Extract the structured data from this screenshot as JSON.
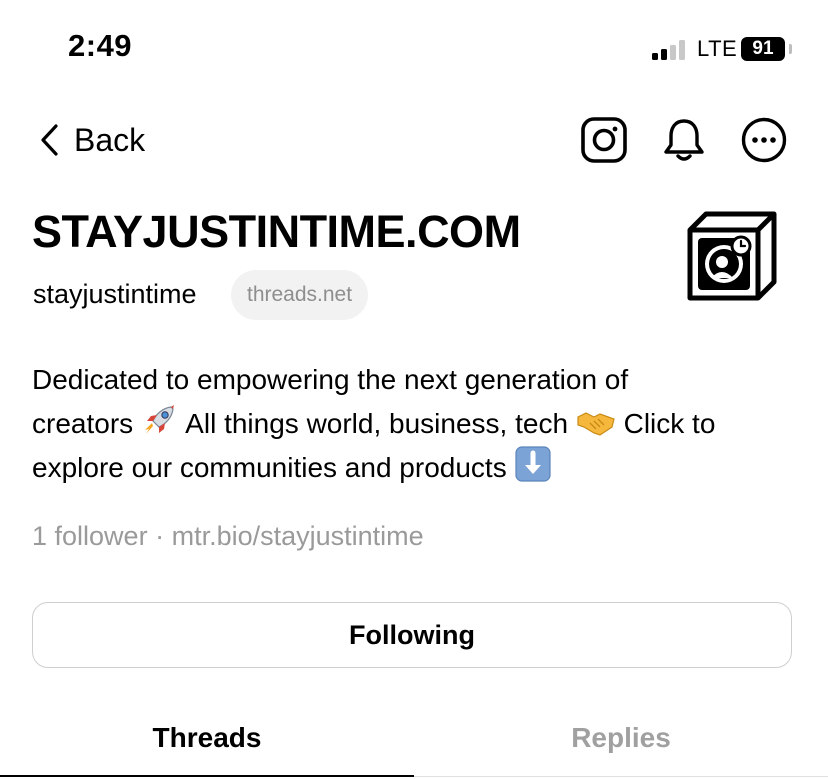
{
  "status_bar": {
    "time": "2:49",
    "network": "LTE",
    "battery": "91"
  },
  "nav": {
    "back_label": "Back",
    "icons": [
      "instagram-icon",
      "bell-icon",
      "more-icon"
    ]
  },
  "profile": {
    "display_name": "STAYJUSTINTIME.COM",
    "username": "stayjustintime",
    "domain_badge": "threads.net",
    "bio": {
      "line1": "Dedicated to empowering the next generation of",
      "line2_part1": "creators",
      "line2_part2": "All things world, business, tech",
      "line2_part3": "Click to",
      "line3": "explore our communities and products"
    },
    "followers": "1 follower",
    "separator": "·",
    "link": "mtr.bio/stayjustintime"
  },
  "actions": {
    "follow_state_label": "Following"
  },
  "tabs": [
    {
      "label": "Threads",
      "active": true
    },
    {
      "label": "Replies",
      "active": false
    }
  ],
  "colors": {
    "text": "#000000",
    "muted": "#9a9a9a",
    "badge_bg": "#f2f2f2",
    "border": "#cfcfcf"
  }
}
